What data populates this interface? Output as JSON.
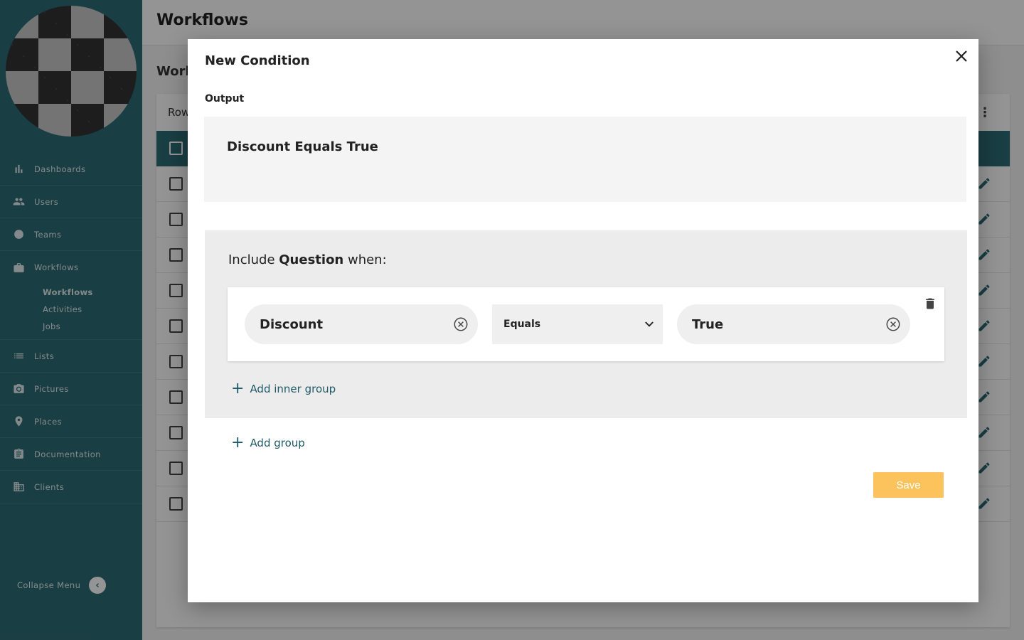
{
  "sidebar": {
    "items": [
      {
        "label": "Dashboards",
        "icon": "bar-chart-icon"
      },
      {
        "label": "Users",
        "icon": "people-icon"
      },
      {
        "label": "Teams",
        "icon": "teams-icon"
      },
      {
        "label": "Workflows",
        "icon": "briefcase-icon"
      },
      {
        "label": "Lists",
        "icon": "list-icon"
      },
      {
        "label": "Pictures",
        "icon": "camera-icon"
      },
      {
        "label": "Places",
        "icon": "location-pin-icon"
      },
      {
        "label": "Documentation",
        "icon": "clipboard-icon"
      },
      {
        "label": "Clients",
        "icon": "building-icon"
      }
    ],
    "sub_items": [
      "Workflows",
      "Activities",
      "Jobs"
    ],
    "collapse_label": "Collapse Menu"
  },
  "page": {
    "title": "Workflows",
    "subtitle": "Work",
    "table_toolbar_label": "Row"
  },
  "modal": {
    "title": "New Condition",
    "output_label": "Output",
    "output_text": "Discount Equals True",
    "include_prefix": "Include ",
    "include_bold": "Question",
    "include_suffix": " when:",
    "condition": {
      "field": "Discount",
      "operator": "Equals",
      "value": "True"
    },
    "add_inner_group_label": "Add inner group",
    "add_group_label": "Add group",
    "save_label": "Save"
  },
  "colors": {
    "sidebar_bg": "#2c6b74",
    "accent": "#1f5a66",
    "save_button": "#fcc25c"
  }
}
